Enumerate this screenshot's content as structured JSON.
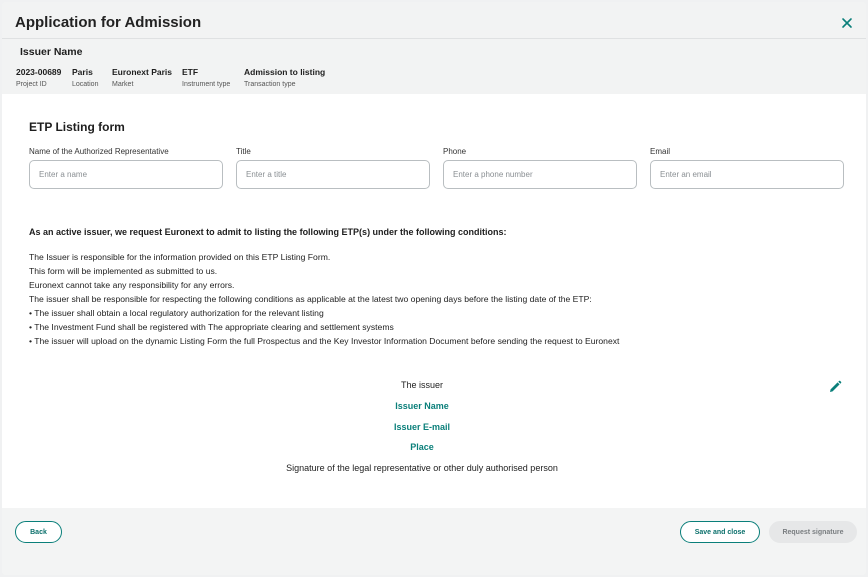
{
  "header": {
    "title": "Application for Admission",
    "issuer_name": "Issuer Name",
    "meta": [
      {
        "value": "2023-00689",
        "label": "Project ID"
      },
      {
        "value": "Paris",
        "label": "Location"
      },
      {
        "value": "Euronext Paris",
        "label": "Market"
      },
      {
        "value": "ETF",
        "label": "Instrument type"
      },
      {
        "value": "Admission to listing",
        "label": "Transaction type"
      }
    ]
  },
  "form": {
    "title": "ETP Listing form",
    "fields": [
      {
        "label": "Name of the Authorized Representative",
        "placeholder": "Enter a name",
        "value": ""
      },
      {
        "label": "Title",
        "placeholder": "Enter a title",
        "value": ""
      },
      {
        "label": "Phone",
        "placeholder": "Enter a phone number",
        "value": ""
      },
      {
        "label": "Email",
        "placeholder": "Enter an email",
        "value": ""
      }
    ]
  },
  "conditions": {
    "heading": "As an active issuer, we request Euronext to admit to listing the following ETP(s) under the following conditions:",
    "lines": [
      "The Issuer is responsible for the information provided on this ETP Listing Form.",
      "This form will be implemented as submitted to us.",
      "Euronext cannot take any responsibility for any errors.",
      "The issuer shall be responsible for respecting the following conditions as applicable at the latest two opening days before the listing date of the ETP:",
      "• The issuer shall obtain a local regulatory authorization for the relevant listing",
      "• The Investment Fund shall be registered with The appropriate clearing and settlement systems",
      "• The issuer will upload on the dynamic Listing Form the full Prospectus and the Key Investor Information Document before sending the request to Euronext"
    ]
  },
  "signature": {
    "the_issuer": "The issuer",
    "issuer_name": "Issuer Name",
    "issuer_email": "Issuer E-mail",
    "place": "Place",
    "caption": "Signature of the legal representative or other duly authorised person"
  },
  "footer": {
    "back_label": "Back",
    "save_label": "Save and close",
    "request_label": "Request signature"
  },
  "icons": {
    "close": "close-icon",
    "edit": "pencil-icon"
  },
  "colors": {
    "accent": "#0a7f7a",
    "disabled_bg": "#e6e7e8"
  }
}
